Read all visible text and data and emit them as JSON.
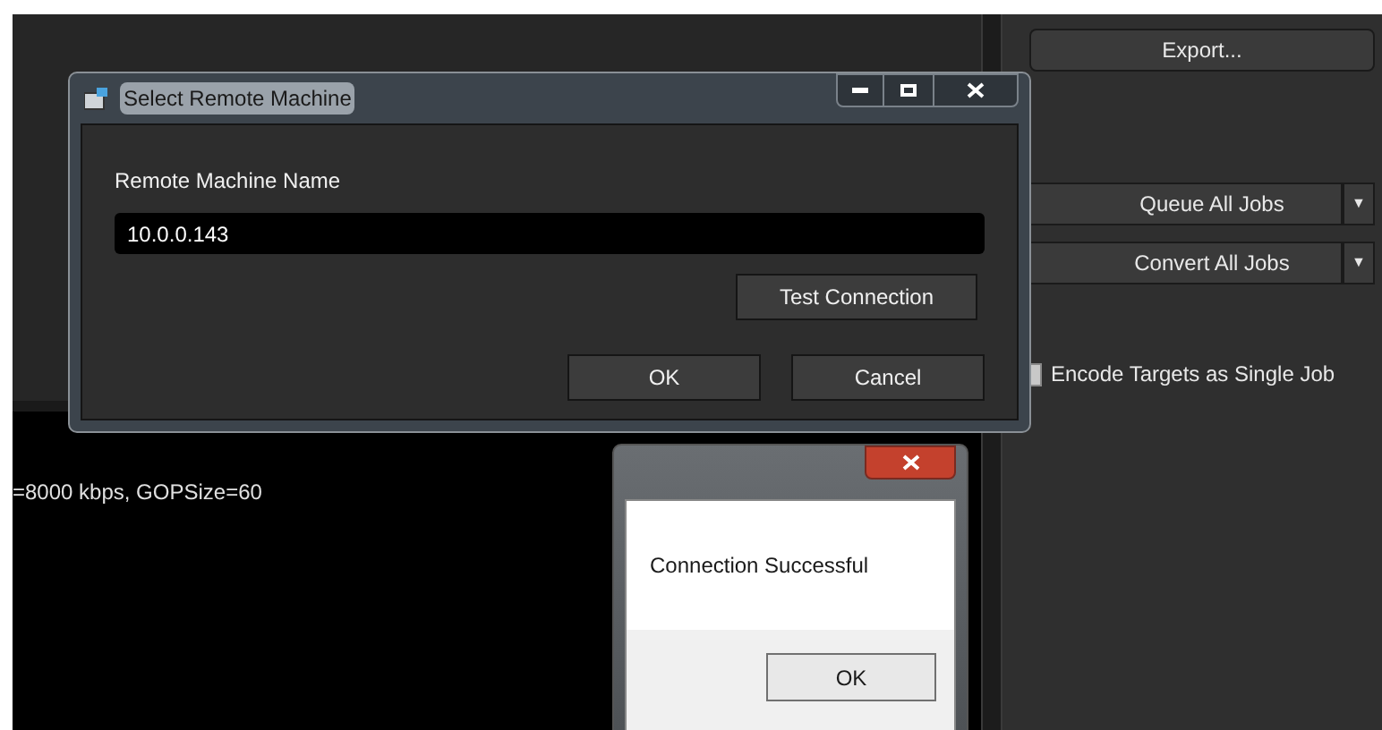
{
  "log": {
    "text": "=8000 kbps, GOPSize=60"
  },
  "side_panel": {
    "export_button": "Export...",
    "split_buttons": [
      {
        "label": "Queue All Jobs",
        "caret": "▼"
      },
      {
        "label": "Convert All Jobs",
        "caret": "▼"
      }
    ],
    "checkbox": {
      "label": "Encode Targets as Single Job",
      "checked": false
    }
  },
  "dialog": {
    "title": "Select Remote Machine",
    "field_label": "Remote Machine Name",
    "value": "10.0.0.143",
    "test_button": "Test Connection",
    "buttons": [
      "OK",
      "Cancel"
    ]
  },
  "message_box": {
    "message": "Connection Successful",
    "button": "OK"
  }
}
